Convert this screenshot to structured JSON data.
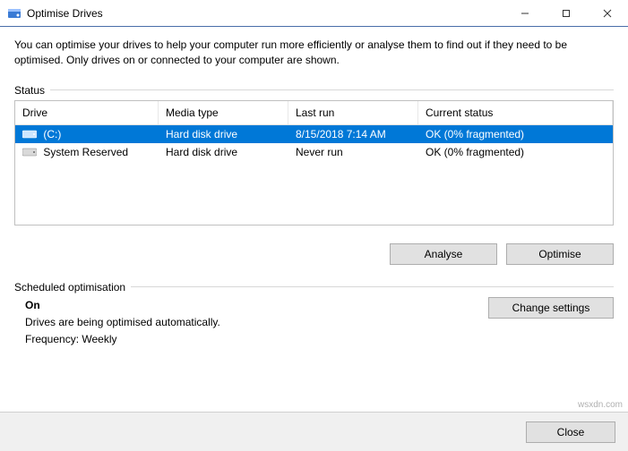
{
  "window": {
    "title": "Optimise Drives"
  },
  "intro": "You can optimise your drives to help your computer run more efficiently or analyse them to find out if they need to be optimised. Only drives on or connected to your computer are shown.",
  "status_label": "Status",
  "columns": {
    "drive": "Drive",
    "media": "Media type",
    "last": "Last run",
    "status": "Current status"
  },
  "drives": [
    {
      "name": "(C:)",
      "media": "Hard disk drive",
      "last": "8/15/2018 7:14 AM",
      "status": "OK (0% fragmented)",
      "selected": true
    },
    {
      "name": "System Reserved",
      "media": "Hard disk drive",
      "last": "Never run",
      "status": "OK (0% fragmented)",
      "selected": false
    }
  ],
  "buttons": {
    "analyse": "Analyse",
    "optimise": "Optimise",
    "change_settings": "Change settings",
    "close": "Close"
  },
  "scheduled": {
    "label": "Scheduled optimisation",
    "state": "On",
    "desc": "Drives are being optimised automatically.",
    "frequency_label": "Frequency:",
    "frequency_value": "Weekly"
  },
  "watermark": "wsxdn.com"
}
